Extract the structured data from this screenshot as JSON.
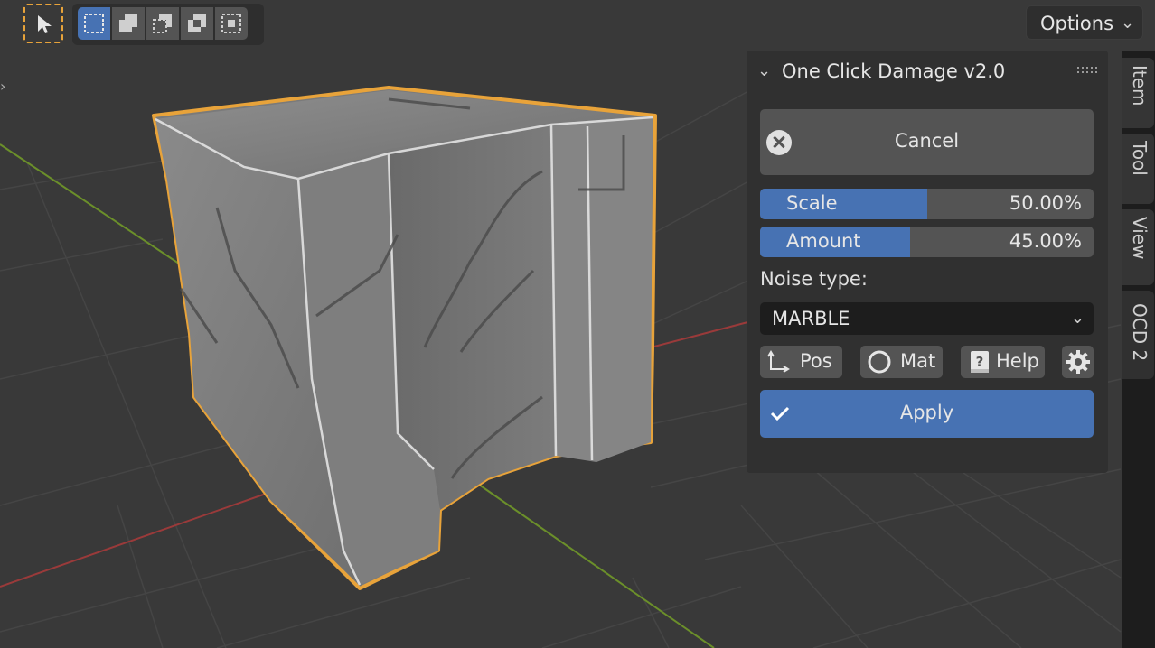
{
  "toolbar": {
    "select_tool_icon": "cursor-arrow-icon",
    "modes": [
      "select-new-icon",
      "select-extend-icon",
      "select-subtract-icon",
      "select-invert-icon",
      "select-intersect-icon"
    ]
  },
  "header": {
    "options_label": "Options"
  },
  "panel": {
    "title": "One Click Damage v2.0",
    "cancel_label": "Cancel",
    "scale": {
      "label": "Scale",
      "value": "50.00%",
      "fraction": 0.5
    },
    "amount": {
      "label": "Amount",
      "value": "45.00%",
      "fraction": 0.45
    },
    "noise_label": "Noise type:",
    "noise_value": "MARBLE",
    "buttons": {
      "pos": "Pos",
      "mat": "Mat",
      "help": "Help"
    },
    "apply_label": "Apply"
  },
  "tabs": [
    "Item",
    "Tool",
    "View",
    "OCD 2"
  ],
  "colors": {
    "accent": "#4772b3",
    "selection_outline": "#e8a33a",
    "background": "#393939",
    "panel": "#303030",
    "button": "#545454"
  }
}
